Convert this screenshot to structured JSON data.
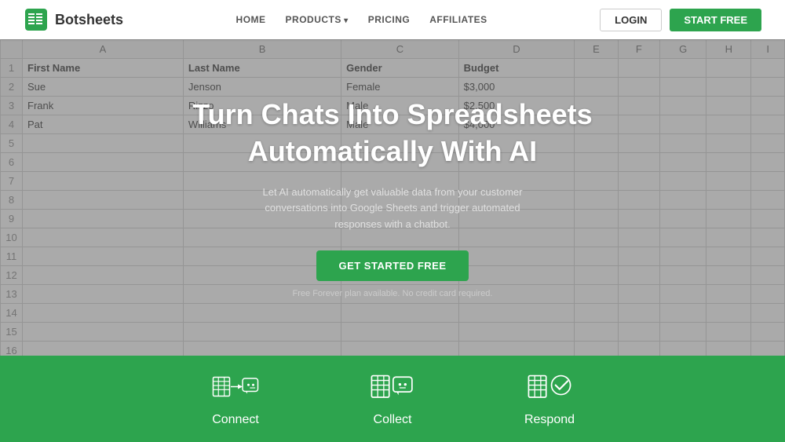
{
  "navbar": {
    "logo_text": "Botsheets",
    "links": [
      {
        "label": "HOME",
        "has_arrow": false
      },
      {
        "label": "PRODUCTS",
        "has_arrow": true
      },
      {
        "label": "PRICING",
        "has_arrow": false
      },
      {
        "label": "AFFILIATES",
        "has_arrow": false
      }
    ],
    "login_label": "LOGIN",
    "start_label": "START FREE"
  },
  "hero": {
    "title_line1": "Turn Chats Into Spreadsheets",
    "title_line2": "Automatically With AI",
    "subtitle": "Let AI automatically get valuable data from your customer conversations into Google Sheets and trigger automated responses with a chatbot.",
    "cta_label": "GET STARTED FREE",
    "note": "Free Forever plan available. No credit card required."
  },
  "spreadsheet": {
    "columns": [
      "A",
      "B",
      "C",
      "D",
      "E",
      "F",
      "G",
      "H",
      "I"
    ],
    "headers": [
      "First Name",
      "Last Name",
      "Gender",
      "Budget"
    ],
    "rows": [
      [
        "Sue",
        "Jenson",
        "Female",
        "$3,000"
      ],
      [
        "Frank",
        "Rizzo",
        "Male",
        "$2,500"
      ],
      [
        "Pat",
        "Williams",
        "Male",
        "$4,000"
      ]
    ],
    "empty_rows": 12
  },
  "features": [
    {
      "label": "Connect",
      "icon": "connect-icon"
    },
    {
      "label": "Collect",
      "icon": "collect-icon"
    },
    {
      "label": "Respond",
      "icon": "respond-icon"
    }
  ]
}
